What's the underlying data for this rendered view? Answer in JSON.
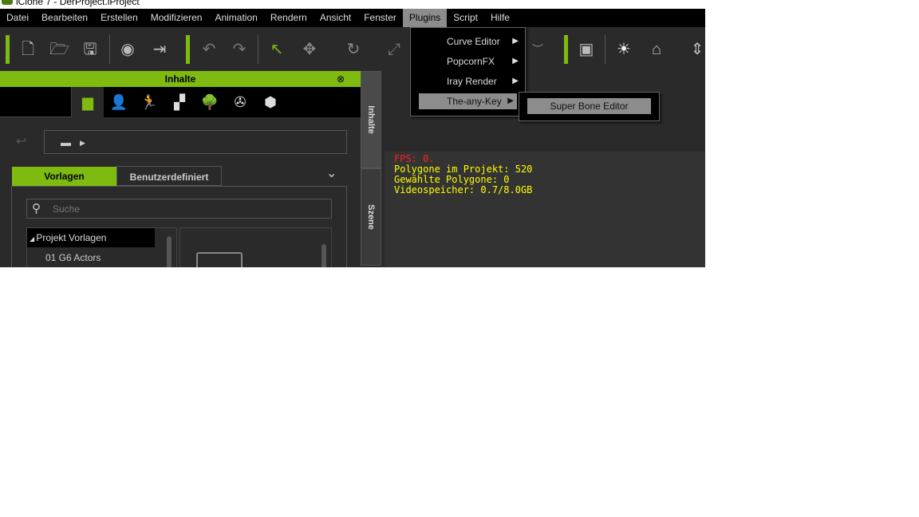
{
  "window": {
    "title": "iClone 7 - DerProject.iProject"
  },
  "menubar": [
    "Datei",
    "Bearbeiten",
    "Erstellen",
    "Modifizieren",
    "Animation",
    "Rendern",
    "Ansicht",
    "Fenster",
    "Plugins",
    "Script",
    "Hilfe"
  ],
  "active_menu": "Plugins",
  "plugins_menu": [
    "Curve Editor",
    "PopcornFX",
    "Iray Render",
    "The-any-Key"
  ],
  "submenu": [
    "Super Bone Editor"
  ],
  "panel": {
    "title": "Inhalte",
    "tabs": [
      "Vorlagen",
      "Benutzerdefiniert"
    ],
    "search_placeholder": "Suche",
    "tree": [
      "Projekt Vorlagen",
      "01 G6 Actors"
    ],
    "side_tabs": [
      "Inhalte",
      "Szene"
    ]
  },
  "viewport": {
    "fps": "FPS: 0.",
    "polygons": "Polygone im Projekt: 520",
    "selected": "Gewählte Polygone: 0",
    "vram": "Videospeicher: 0.7/8.0GB"
  },
  "colors": {
    "accent": "#7fba10",
    "fps": "#ff2020",
    "stats": "#ffff00"
  }
}
